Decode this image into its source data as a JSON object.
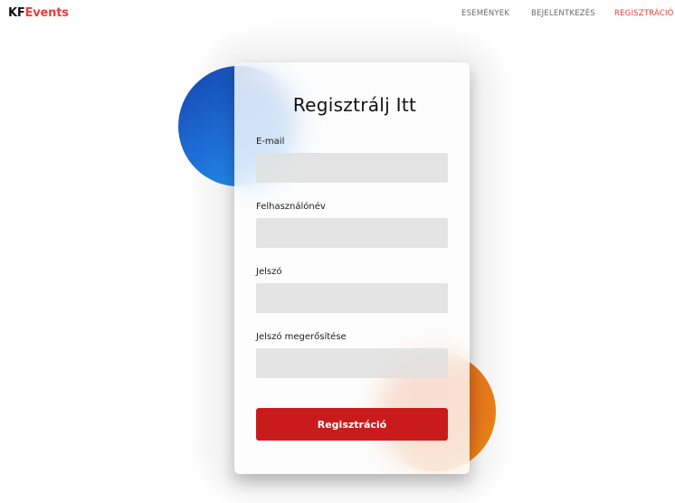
{
  "navbar": {
    "logo_kf": "KF",
    "logo_events": "Events",
    "links": [
      {
        "label": "ESEMÉNYEK",
        "active": false
      },
      {
        "label": "BEJELENTKEZÉS",
        "active": false
      },
      {
        "label": "REGISZTRÁCIÓ",
        "active": true
      }
    ],
    "brand_color": "#ef3b3b"
  },
  "form": {
    "title": "Regisztrálj Itt",
    "fields": [
      {
        "label": "E-mail",
        "value": "",
        "type": "email"
      },
      {
        "label": "Felhasználónév",
        "value": "",
        "type": "text"
      },
      {
        "label": "Jelszó",
        "value": "",
        "type": "password"
      },
      {
        "label": "Jelszó megerősítése",
        "value": "",
        "type": "password"
      }
    ],
    "submit_label": "Regisztráció",
    "submit_color": "#c91b1b"
  },
  "decor": {
    "blue_circle": "blue-gradient-circle",
    "orange_circle": "orange-gradient-circle"
  }
}
